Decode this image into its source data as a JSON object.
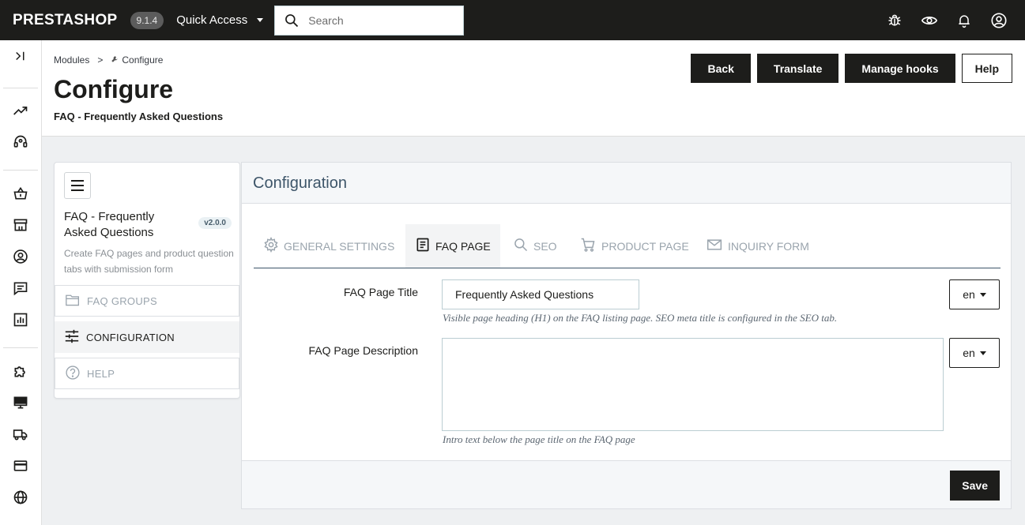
{
  "topbar": {
    "logo": "PRESTASHOP",
    "version": "9.1.4",
    "quick_access": "Quick Access",
    "search_placeholder": "Search",
    "icons": [
      "bug-icon",
      "eye-icon",
      "bell-icon",
      "user-icon"
    ]
  },
  "sidenav": {
    "icons": [
      "expand-icon",
      "trending-icon",
      "headset-icon",
      "basket-icon",
      "store-icon",
      "customer-icon",
      "message-icon",
      "stats-icon",
      "puzzle-icon",
      "monitor-icon",
      "truck-icon",
      "credit-card-icon",
      "globe-icon"
    ]
  },
  "header": {
    "breadcrumb": [
      "Modules",
      "Configure"
    ],
    "breadcrumb_sep": ">",
    "title": "Configure",
    "subtitle": "FAQ - Frequently Asked Questions",
    "actions": {
      "back": "Back",
      "translate": "Translate",
      "manage_hooks": "Manage hooks",
      "help": "Help"
    }
  },
  "module": {
    "name": "FAQ - Frequently Asked Questions",
    "version": "v2.0.0",
    "description": "Create FAQ pages and product question tabs with submission form",
    "nav": [
      {
        "label": "FAQ GROUPS",
        "icon": "folder-icon",
        "active": false
      },
      {
        "label": "CONFIGURATION",
        "icon": "sliders-icon",
        "active": true
      },
      {
        "label": "HELP",
        "icon": "help-circle-icon",
        "active": false
      }
    ]
  },
  "config": {
    "title": "Configuration",
    "tabs": [
      {
        "label": "GENERAL SETTINGS",
        "icon": "gear-icon",
        "active": false
      },
      {
        "label": "FAQ PAGE",
        "icon": "document-icon",
        "active": true
      },
      {
        "label": "SEO",
        "icon": "search-icon",
        "active": false
      },
      {
        "label": "PRODUCT PAGE",
        "icon": "cart-icon",
        "active": false
      },
      {
        "label": "INQUIRY FORM",
        "icon": "mail-icon",
        "active": false
      }
    ],
    "fields": {
      "page_title_label": "FAQ Page Title",
      "page_title_value": "Frequently Asked Questions",
      "page_title_help": "Visible page heading (H1) on the FAQ listing page. SEO meta title is configured in the SEO tab.",
      "page_desc_label": "FAQ Page Description",
      "page_desc_value": "",
      "page_desc_help": "Intro text below the page title on the FAQ page",
      "lang": "en"
    },
    "save": "Save"
  }
}
